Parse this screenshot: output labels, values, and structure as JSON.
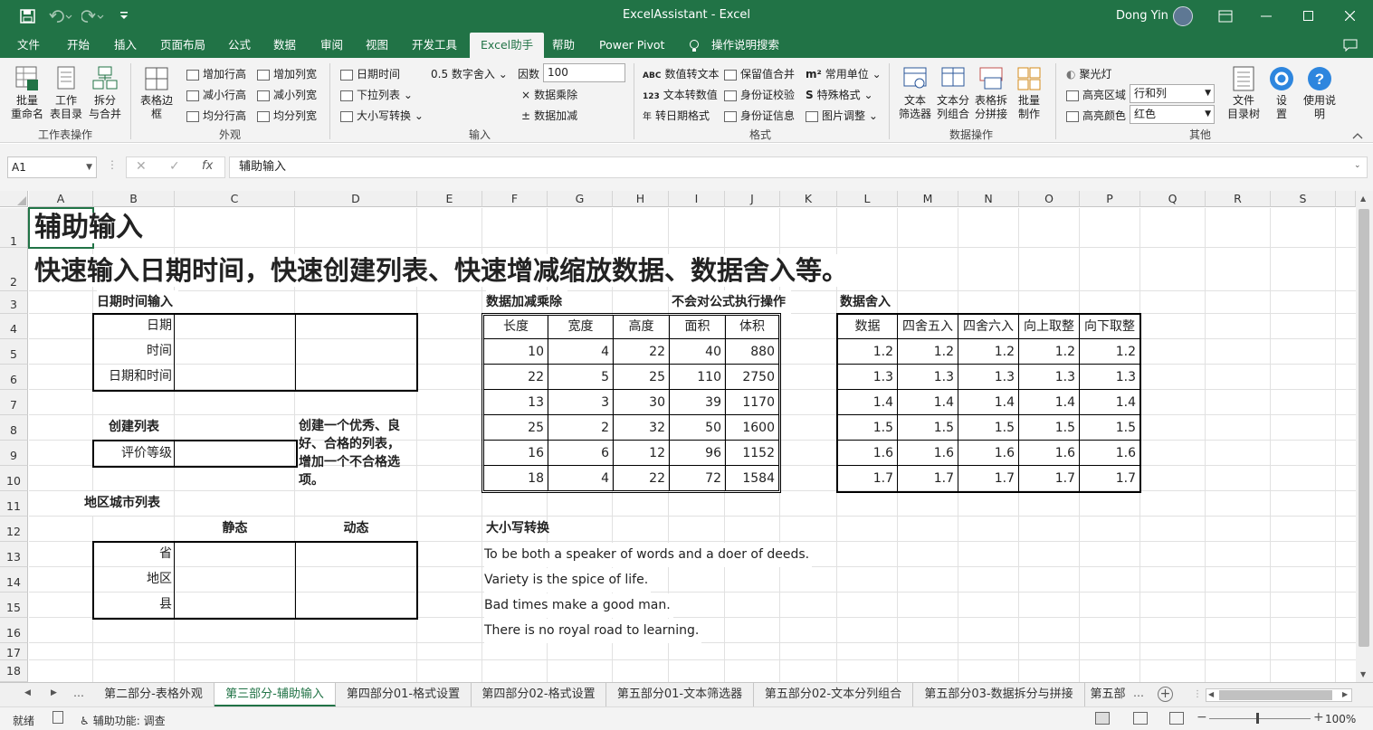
{
  "window": {
    "title": "ExcelAssistant  -  Excel",
    "user": "Dong Yin",
    "colors": {
      "excel_green": "#217346",
      "ribbon_bg": "#f3f3f3"
    }
  },
  "tabs": [
    "文件",
    "开始",
    "插入",
    "页面布局",
    "公式",
    "数据",
    "审阅",
    "视图",
    "开发工具",
    "Excel助手",
    "帮助",
    "Power Pivot",
    "操作说明搜索"
  ],
  "active_tab": "Excel助手",
  "ribbon": {
    "groups": {
      "sheet_ops": {
        "label": "工作表操作",
        "buttons": [
          "批量\n重命名",
          "工作\n表目录",
          "拆分\n与合并"
        ]
      },
      "appearance": {
        "label": "外观",
        "big": "表格边\n框",
        "items": [
          "增加行高",
          "减小行高",
          "均分行高",
          "增加列宽",
          "减小列宽",
          "均分列宽"
        ]
      },
      "input": {
        "label": "输入",
        "items": [
          "日期时间",
          "下拉列表",
          "大小写转换",
          "0.5 数字舍入",
          "因数",
          "数据乘除",
          "数据加减"
        ],
        "factor_value": "100"
      },
      "format": {
        "label": "格式",
        "items": [
          "数值转文本",
          "文本转数值",
          "转日期格式",
          "保留值合并",
          "身份证校验",
          "身份证信息",
          "常用单位",
          "特殊格式",
          "图片调整"
        ]
      },
      "data_ops": {
        "label": "数据操作",
        "buttons": [
          "文本\n筛选器",
          "文本分\n列组合",
          "表格拆\n分拼接",
          "批量\n制作"
        ]
      },
      "other": {
        "label": "其他",
        "spotlight": "聚光灯",
        "highlight_area_label": "高亮区域",
        "highlight_area_value": "行和列",
        "highlight_color_label": "高亮颜色",
        "highlight_color_value": "红色",
        "buttons": [
          "文件\n目录树",
          "设\n置",
          "使用说\n明"
        ]
      }
    }
  },
  "formula_bar": {
    "name_box": "A1",
    "formula": "辅助输入"
  },
  "columns": [
    "A",
    "B",
    "C",
    "D",
    "E",
    "F",
    "G",
    "H",
    "I",
    "J",
    "K",
    "L",
    "M",
    "N",
    "O",
    "P",
    "Q",
    "R",
    "S"
  ],
  "rows": [
    "1",
    "2",
    "3",
    "4",
    "5",
    "6",
    "7",
    "8",
    "9",
    "10",
    "11",
    "12",
    "13",
    "14",
    "15",
    "16",
    "17",
    "18"
  ],
  "sheet": {
    "title": "辅助输入",
    "subtitle": "快速输入日期时间，快速创建列表、快速增减缩放数据、数据舍入等。",
    "datetime_header": "日期时间输入",
    "datetime_rows": [
      "日期",
      "时间",
      "日期和时间"
    ],
    "list_header": "创建列表",
    "list_row": "评价等级",
    "list_note": [
      "创建一个优秀、良",
      "好、合格的列表，",
      "增加一个不合格选",
      "项。"
    ],
    "region_header": "地区城市列表",
    "region_cols": [
      "静态",
      "动态"
    ],
    "region_rows": [
      "省",
      "地区",
      "县"
    ],
    "calc_header": "数据加减乘除",
    "calc_note": "不会对公式执行操作",
    "calc_cols": [
      "长度",
      "宽度",
      "高度",
      "面积",
      "体积"
    ],
    "calc_rows": [
      [
        "10",
        "4",
        "22",
        "40",
        "880"
      ],
      [
        "22",
        "5",
        "25",
        "110",
        "2750"
      ],
      [
        "13",
        "3",
        "30",
        "39",
        "1170"
      ],
      [
        "25",
        "2",
        "32",
        "50",
        "1600"
      ],
      [
        "16",
        "6",
        "12",
        "96",
        "1152"
      ],
      [
        "18",
        "4",
        "22",
        "72",
        "1584"
      ]
    ],
    "round_header": "数据舍入",
    "round_cols": [
      "数据",
      "四舍五入",
      "四舍六入",
      "向上取整",
      "向下取整"
    ],
    "round_rows": [
      [
        "1.2",
        "1.2",
        "1.2",
        "1.2",
        "1.2"
      ],
      [
        "1.3",
        "1.3",
        "1.3",
        "1.3",
        "1.3"
      ],
      [
        "1.4",
        "1.4",
        "1.4",
        "1.4",
        "1.4"
      ],
      [
        "1.5",
        "1.5",
        "1.5",
        "1.5",
        "1.5"
      ],
      [
        "1.6",
        "1.6",
        "1.6",
        "1.6",
        "1.6"
      ],
      [
        "1.7",
        "1.7",
        "1.7",
        "1.7",
        "1.7"
      ]
    ],
    "case_header": "大小写转换",
    "case_lines": [
      "To be both a speaker of words and a doer of deeds.",
      "Variety is the spice of life.",
      "Bad times make a good man.",
      "There is no royal road to learning."
    ]
  },
  "sheet_tabs": [
    "第二部分-表格外观",
    "第三部分-辅助输入",
    "第四部分01-格式设置",
    "第四部分02-格式设置",
    "第五部分01-文本筛选器",
    "第五部分02-文本分列组合",
    "第五部分03-数据拆分与拼接",
    "第五部"
  ],
  "active_sheet": "第三部分-辅助输入",
  "status": {
    "mode": "就绪",
    "accessibility": "辅助功能: 调查",
    "zoom": "100%"
  }
}
